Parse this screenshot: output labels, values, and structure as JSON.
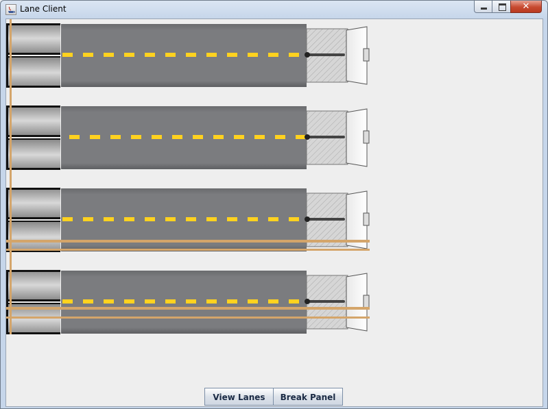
{
  "window": {
    "title": "Lane Client",
    "controls": {
      "minimize": "minimize-icon",
      "maximize": "maximize-icon",
      "close": "close-icon"
    }
  },
  "lanes": {
    "count": 4,
    "colors": {
      "road": "#7a7b7e",
      "dash": "#ffd21f",
      "feeder": "#d9d9d9",
      "rail": "#d4a56a",
      "background": "#eeeeee"
    }
  },
  "buttons": {
    "view_lanes": "View Lanes",
    "break_panel": "Break Panel"
  }
}
